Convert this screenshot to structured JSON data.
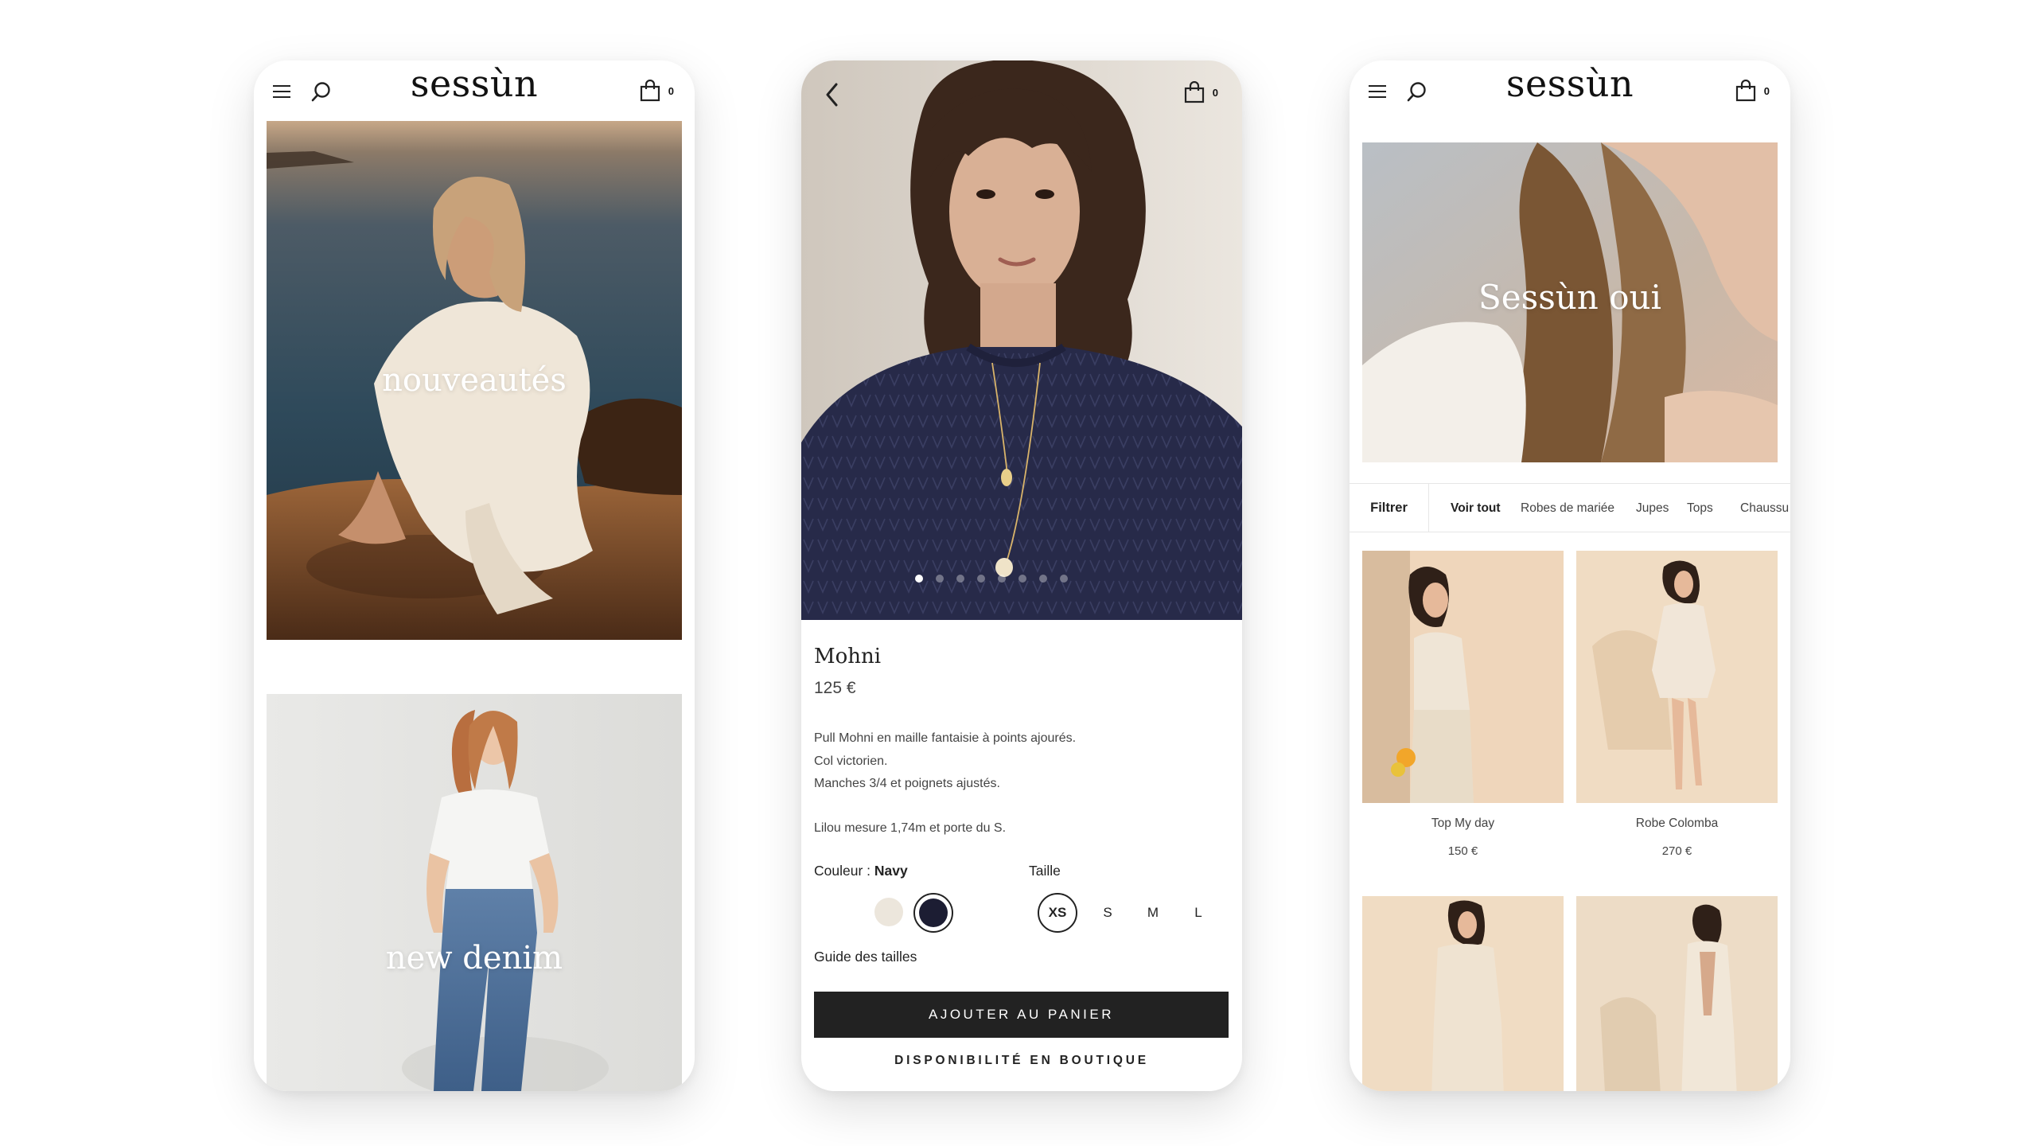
{
  "brand": {
    "logo": "sessùn"
  },
  "icons": {
    "menu": "hamburger-menu-icon",
    "search": "search-icon",
    "bag": "shopping-bag-icon",
    "back": "chevron-left-icon"
  },
  "cart": {
    "count": "0"
  },
  "home": {
    "heroes": [
      {
        "title": "nouveautés"
      },
      {
        "title": "new denim"
      }
    ]
  },
  "product": {
    "name": "Mohni",
    "price": "125 €",
    "description": [
      "Pull Mohni en maille fantaisie à points ajourés.",
      "Col victorien.",
      "Manches 3/4 et poignets ajustés.",
      "Lilou mesure 1,74m et porte du S."
    ],
    "image_count": 8,
    "active_image": 1,
    "color_label": "Couleur :",
    "color_value": "Navy",
    "colors": [
      "#ece6dc",
      "#1c1d33"
    ],
    "size_label": "Taille",
    "sizes": [
      "XS",
      "S",
      "M",
      "L"
    ],
    "selected_size": "XS",
    "size_guide": "Guide des tailles",
    "add_to_cart": "AJOUTER AU PANIER",
    "store_availability": "DISPONIBILITÉ EN BOUTIQUE"
  },
  "collection": {
    "title": "Sessùn oui",
    "filter_label": "Filtrer",
    "categories": [
      "Voir tout",
      "Robes de mariée",
      "Jupes",
      "Tops",
      "Chaussu"
    ],
    "active_category": "Voir tout",
    "products": [
      {
        "name": "Top My day",
        "price": "150 €"
      },
      {
        "name": "Robe Colomba",
        "price": "270 €"
      },
      {
        "name": "",
        "price": ""
      },
      {
        "name": "",
        "price": ""
      }
    ]
  },
  "colors": {
    "dark": "#222222",
    "navy": "#1c1d33",
    "cream": "#ece6dc",
    "beige": "#f2dcc2"
  }
}
